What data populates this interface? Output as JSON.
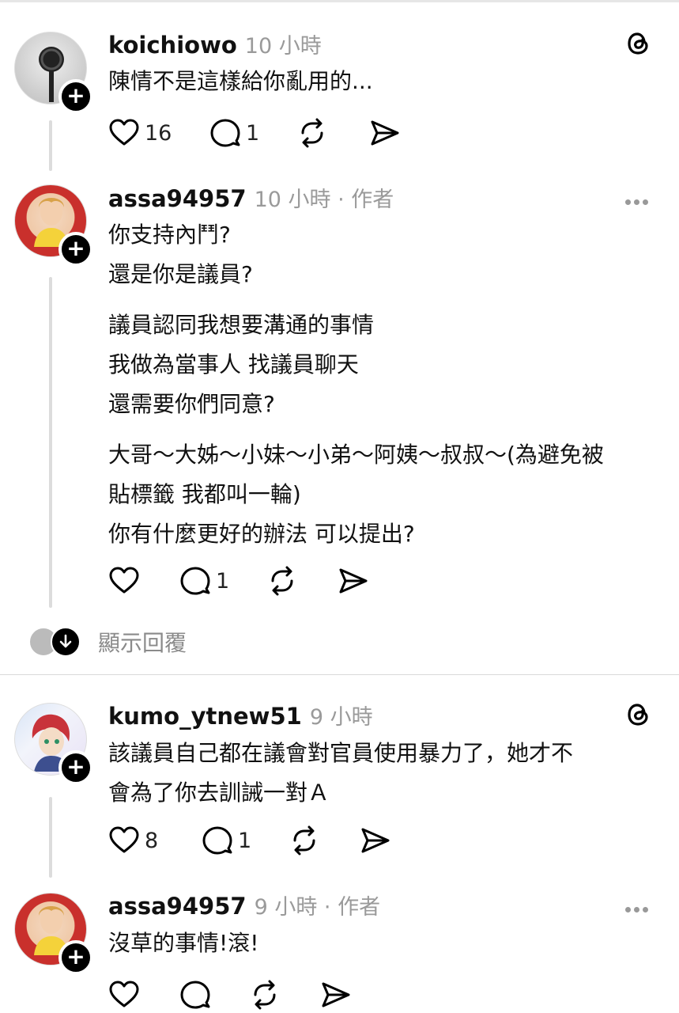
{
  "posts": [
    {
      "username": "koichiowo",
      "meta": "10 小時",
      "lines": [
        "陳情不是這樣給你亂用的..."
      ],
      "likes": "16",
      "replies": "1"
    },
    {
      "username": "assa94957",
      "meta": "10 小時 · 作者",
      "paragraphs": [
        [
          "你支持內鬥?",
          "還是你是議員?"
        ],
        [
          "議員認同我想要溝通的事情",
          "我做為當事人 找議員聊天",
          "還需要你們同意?"
        ],
        [
          "大哥～大姊～小妹～小弟～阿姨～叔叔～(為避免被",
          "貼標籤 我都叫一輪)",
          "你有什麼更好的辦法 可以提出?"
        ]
      ],
      "likes": "",
      "replies": "1"
    },
    {
      "username": "kumo_ytnew51",
      "meta": "9 小時",
      "lines": [
        "該議員自己都在議會對官員使用暴力了，她才不",
        "會為了你去訓誡一對Ａ"
      ],
      "likes": "8",
      "replies": "1"
    },
    {
      "username": "assa94957",
      "meta": "9 小時 · 作者",
      "lines": [
        "沒草的事情!滾!"
      ],
      "likes": "",
      "replies": ""
    }
  ],
  "show_replies_label": "顯示回覆",
  "icons": [
    "threads-logo-icon",
    "heart-icon",
    "comment-icon",
    "repost-icon",
    "share-icon",
    "more-icon",
    "plus-icon",
    "arrow-down-icon"
  ],
  "colors": {
    "text": "#111111",
    "muted": "#9a9a9a",
    "divider": "#d9d9d9",
    "thread_line": "#dcdcdc"
  }
}
